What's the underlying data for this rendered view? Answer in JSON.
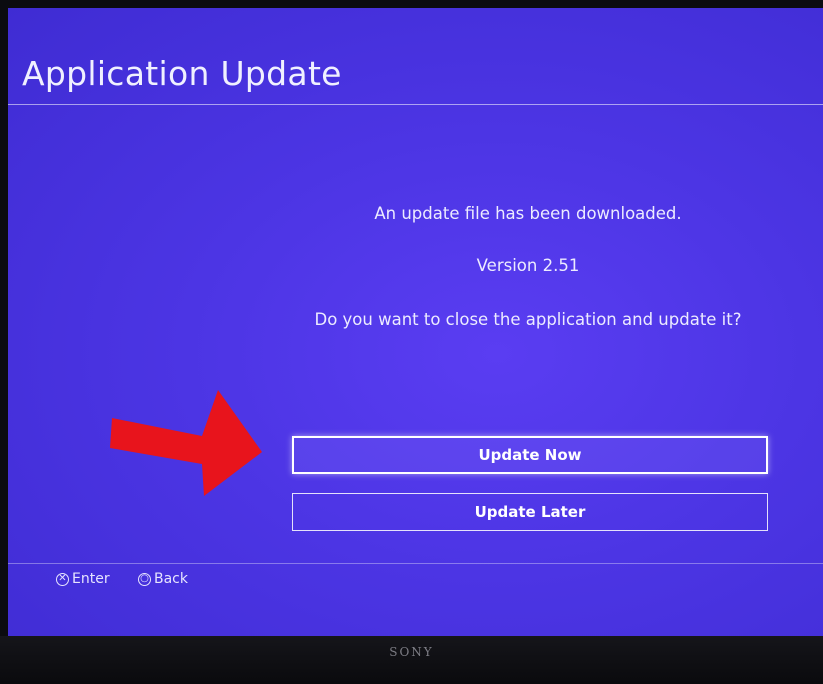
{
  "screen": {
    "title": "Application Update",
    "message": "An update file has been downloaded.",
    "version": "Version 2.51",
    "question": "Do you want to close the application and update it?"
  },
  "buttons": {
    "update_now": "Update Now",
    "update_later": "Update Later"
  },
  "footer": {
    "enter_label": "Enter",
    "back_label": "Back",
    "enter_icon": "cross-button-icon",
    "back_icon": "circle-button-icon"
  },
  "device": {
    "brand": "SONY"
  },
  "colors": {
    "background": "#4c35e4",
    "text": "#ecebff",
    "arrow": "#e8141c"
  }
}
